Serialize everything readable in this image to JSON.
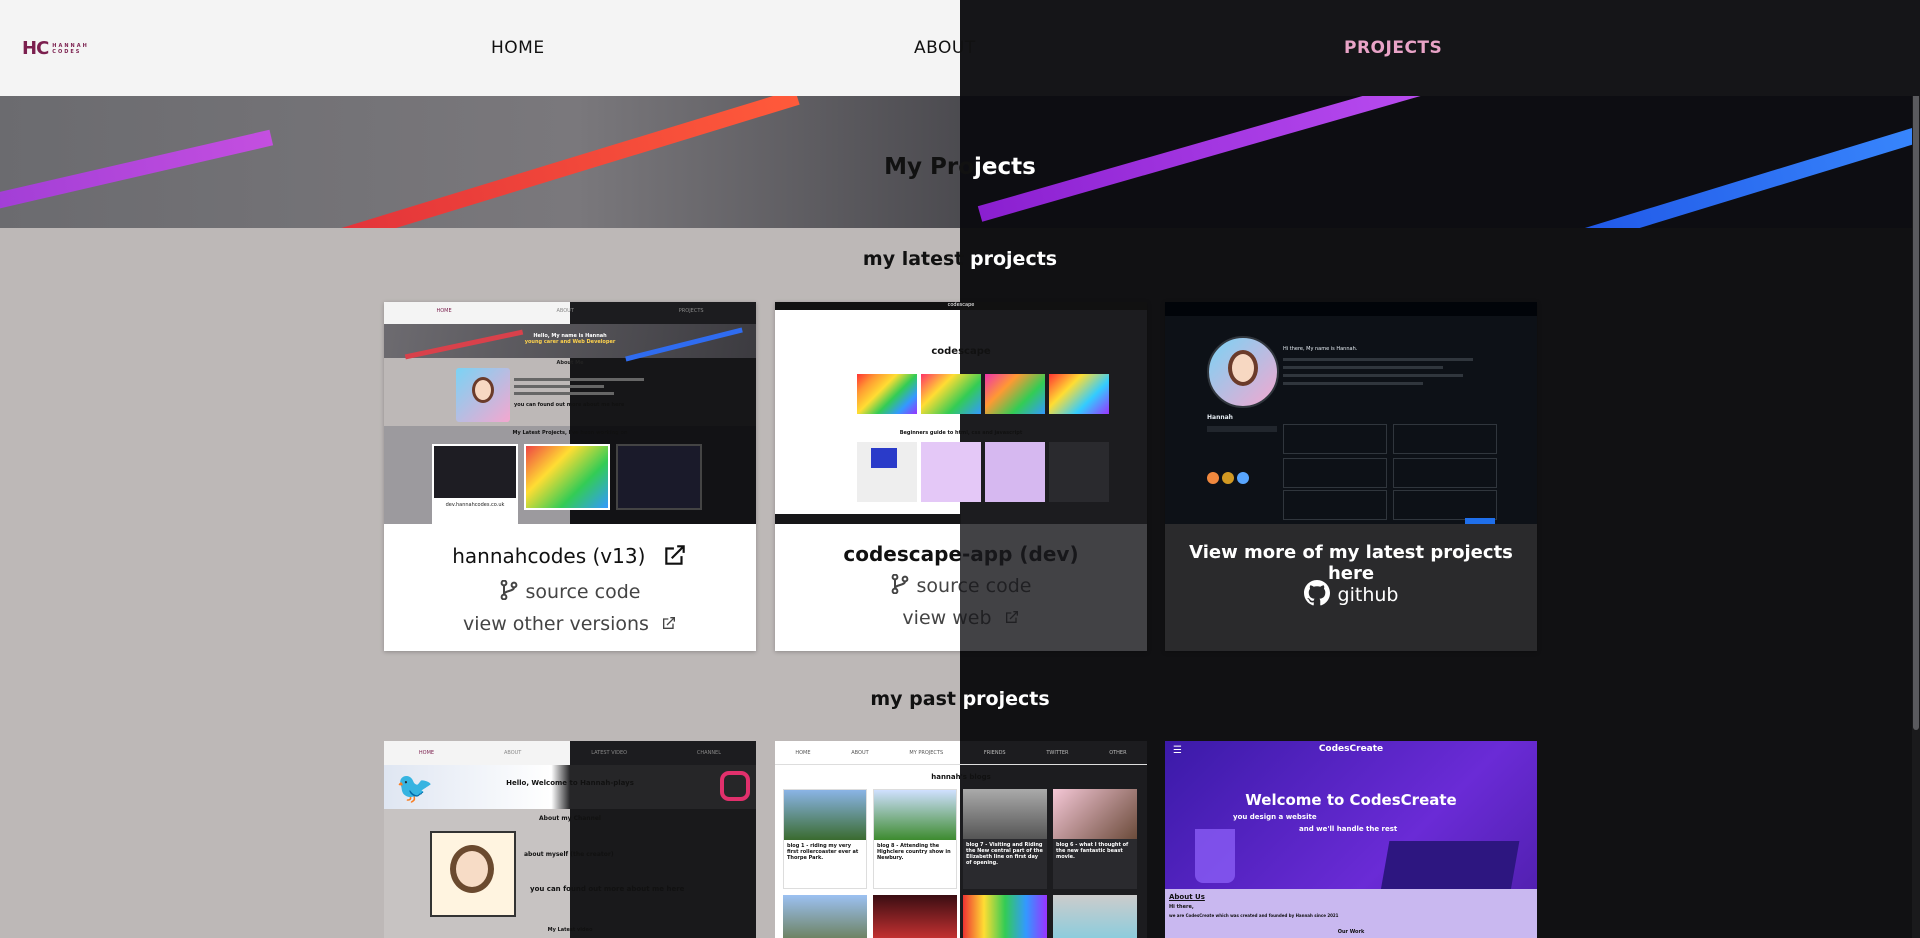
{
  "nav": {
    "logo_mark": "HC",
    "logo_text_1": "HANNAH",
    "logo_text_2": "CODES",
    "home": "HOME",
    "about": "ABOUT",
    "projects": "PROJECTS"
  },
  "hero": {
    "title_left": "My Pro",
    "title_right": "jects"
  },
  "latest": {
    "title_left": "my latest ",
    "title_right": "projects",
    "cards": [
      {
        "title": "hannahcodes (v13)",
        "link1": "source code",
        "link2": "view other versions"
      },
      {
        "title": "codescape-app (dev)",
        "link1": "source code",
        "link2": "view web"
      },
      {
        "title": "View more of my latest projects here",
        "link1": "github"
      }
    ]
  },
  "past": {
    "title_left": "my past ",
    "title_right": "projects"
  },
  "thumbs": {
    "t1_nav": [
      "HOME",
      "ABOUT",
      "PROJECTS"
    ],
    "t1_hello": "Hello, My name is Hannah",
    "t1_sub": "young carer and Web Developer",
    "t1_about": "About Me",
    "t1_more": "you can found out more about me here",
    "t1_latest": "My Latest Projects, I've been working on",
    "t1_link": "dev.hannahcodes.co.uk",
    "t2_brand": "codescape",
    "t2_title": "codescape",
    "t2_guide": "Beginners guide to html, css and javascript",
    "t3_name": "Hannah",
    "t3_hi": "Hi there, My name is Hannah.",
    "p1_nav": [
      "HOME",
      "ABOUT",
      "LATEST VIDEO",
      "CHANNEL"
    ],
    "p1_welcome": "Hello, Welcome to Hannah-plays",
    "p1_about": "About my Channel",
    "p1_creator": "about myself (the creator)",
    "p1_more": "you can found out more about me here",
    "p1_latest": "My Latest video",
    "p2_nav": [
      "HOME",
      "ABOUT",
      "MY PROJECTS",
      "FRIENDS",
      "TWITTER",
      "OTHER"
    ],
    "p2_title": "hannah's blogs",
    "p2_blogs": [
      "blog 1 - riding my very first rollercoaster ever at Thorpe Park.",
      "blog 8 - Attending the Highclere country show in Newbury.",
      "blog 7 - Visiting and Riding the New central part of the Elizabeth line on first day of opening.",
      "blog 6 - what I thought of the new fantastic beast movie."
    ],
    "p3_brand": "CodesCreate",
    "p3_welcome": "Welcome to CodesCreate",
    "p3_design": "you design a website",
    "p3_handle": "and we'll handle the rest",
    "p3_about": "About Us",
    "p3_hi": "Hi there,",
    "p3_text": "we are CodesCreate which was created and founded by Hannah since 2021",
    "p3_work": "Our Work"
  },
  "colors": {
    "accent": "#e9a3c7",
    "brand": "#7b1f4e",
    "dark_bg": "#111113",
    "light_bg": "#bdb8b7"
  }
}
